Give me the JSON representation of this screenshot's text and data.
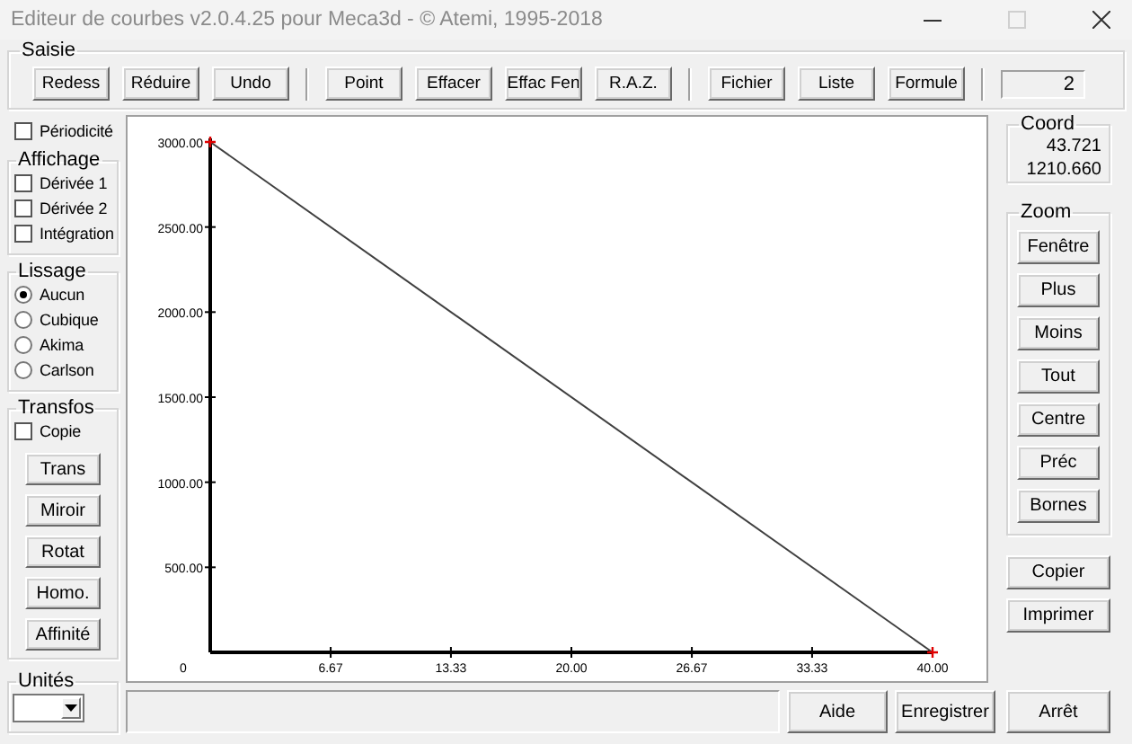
{
  "window": {
    "title": "Editeur de courbes v2.0.4.25 pour Meca3d - © Atemi, 1995-2018",
    "maximize_disabled": true
  },
  "saisie": {
    "label": "Saisie",
    "groups": [
      [
        "Redess",
        "Réduire",
        "Undo"
      ],
      [
        "Point",
        "Effacer",
        "Effac Fen",
        "R.A.Z."
      ],
      [
        "Fichier",
        "Liste",
        "Formule"
      ]
    ],
    "counter": "2"
  },
  "periodicity": {
    "label": "Périodicité",
    "checked": false
  },
  "affichage": {
    "label": "Affichage",
    "options": [
      {
        "label": "Dérivée 1",
        "checked": false
      },
      {
        "label": "Dérivée 2",
        "checked": false
      },
      {
        "label": "Intégration",
        "checked": false
      }
    ]
  },
  "lissage": {
    "label": "Lissage",
    "options": [
      {
        "label": "Aucun",
        "selected": true
      },
      {
        "label": "Cubique",
        "selected": false
      },
      {
        "label": "Akima",
        "selected": false
      },
      {
        "label": "Carlson",
        "selected": false
      }
    ]
  },
  "transfos": {
    "label": "Transfos",
    "copy": {
      "label": "Copie",
      "checked": false
    },
    "buttons": [
      "Trans",
      "Miroir",
      "Rotat",
      "Homo.",
      "Affinité"
    ]
  },
  "unites": {
    "label": "Unités"
  },
  "plot": {
    "origin_label": "0",
    "chart_data": {
      "type": "line",
      "x": [
        0,
        40
      ],
      "series": [
        {
          "color": "#404040",
          "values": [
            3000,
            0
          ]
        }
      ],
      "xlim": [
        0,
        40
      ],
      "ylim": [
        0,
        3000
      ],
      "xticks": [
        {
          "value": 6.67,
          "label": "6.67"
        },
        {
          "value": 13.33,
          "label": "13.33"
        },
        {
          "value": 20,
          "label": "20.00"
        },
        {
          "value": 26.67,
          "label": "26.67"
        },
        {
          "value": 33.33,
          "label": "33.33"
        },
        {
          "value": 40,
          "label": "40.00"
        }
      ],
      "yticks": [
        {
          "value": 500,
          "label": "500.00"
        },
        {
          "value": 1000,
          "label": "1000.00"
        },
        {
          "value": 1500,
          "label": "1500.00"
        },
        {
          "value": 2000,
          "label": "2000.00"
        },
        {
          "value": 2500,
          "label": "2500.00"
        },
        {
          "value": 3000,
          "label": "3000.00"
        }
      ]
    }
  },
  "coord": {
    "label": "Coord",
    "values": [
      "43.721",
      "1210.660"
    ]
  },
  "zoom": {
    "label": "Zoom",
    "buttons": [
      "Fenêtre",
      "Plus",
      "Moins",
      "Tout",
      "Centre",
      "Préc",
      "Bornes"
    ]
  },
  "actions": [
    "Copier",
    "Imprimer"
  ],
  "status_bar": {
    "buttons": [
      "Aide",
      "Enregistrer",
      "Arrêt"
    ]
  }
}
